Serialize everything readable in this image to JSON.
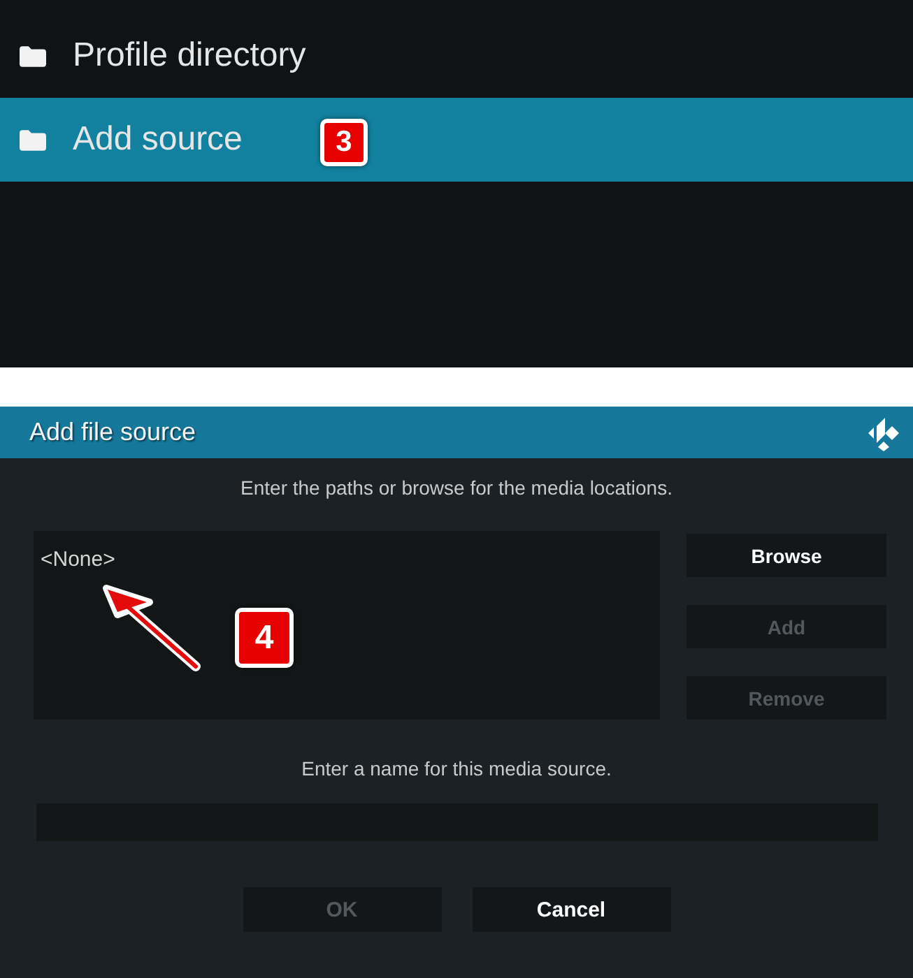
{
  "menu": {
    "items": [
      {
        "label": "Profile directory",
        "selected": false
      },
      {
        "label": "Add source",
        "selected": true,
        "callout": "3"
      }
    ]
  },
  "dialog": {
    "title": "Add file source",
    "instruction": "Enter the paths or browse for the media locations.",
    "paths_box": {
      "paths": [
        "<None>"
      ],
      "callout": "4",
      "pointer_arrow": true
    },
    "side_buttons": [
      {
        "label": "Browse",
        "disabled": false
      },
      {
        "label": "Add",
        "disabled": true
      },
      {
        "label": "Remove",
        "disabled": true
      }
    ],
    "name_prompt": "Enter a name for this media source.",
    "footer_buttons": [
      {
        "label": "OK",
        "disabled": true
      },
      {
        "label": "Cancel",
        "disabled": false
      }
    ]
  }
}
